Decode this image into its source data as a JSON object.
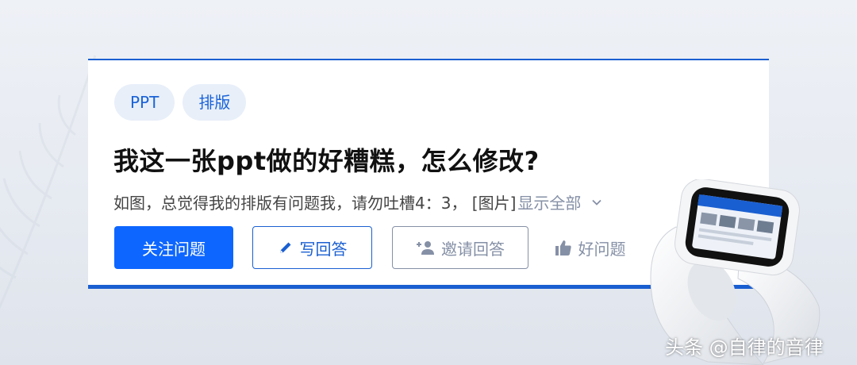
{
  "tags": [
    "PPT",
    "排版"
  ],
  "question": {
    "title": "我这一张ppt做的好糟糕，怎么修改?",
    "description": "如图，总觉得我的排版有问题我，请勿吐槽4：3，  [图片]",
    "show_all_label": "显示全部"
  },
  "actions": {
    "follow_label": "关注问题",
    "write_label": "写回答",
    "invite_label": "邀请回答",
    "good_question_label": "好问题"
  },
  "watermark": "头条 @自律的音律",
  "icons": [
    "pencil-icon",
    "add-person-icon",
    "thumbs-up-icon",
    "chevron-down-icon"
  ],
  "colors": {
    "accent": "#0d66ff",
    "brand_border": "#1a5fd1",
    "muted": "#8590a6",
    "tag_bg": "#e8eff9"
  }
}
